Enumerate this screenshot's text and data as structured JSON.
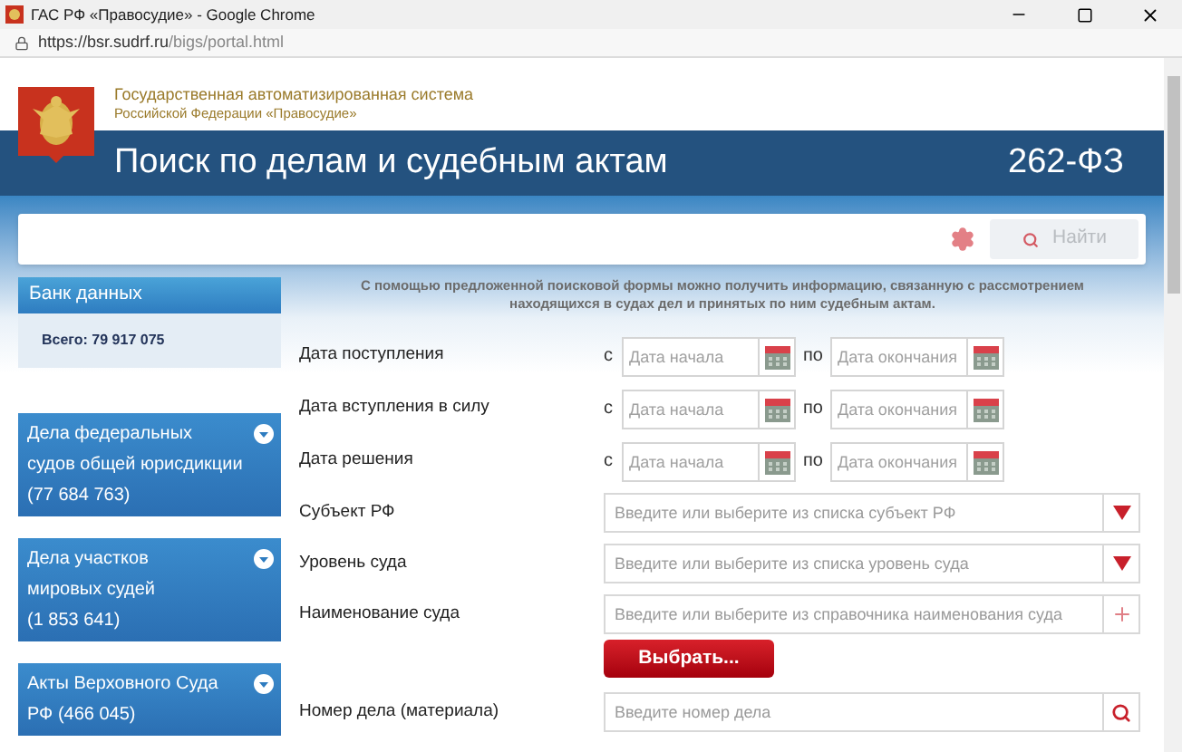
{
  "browser": {
    "tab_title": "ГАС РФ «Правосудие» - Google Chrome",
    "url_host": "https://bsr.sudrf.ru",
    "url_path": "/bigs/portal.html"
  },
  "header": {
    "system_name": "Государственная автоматизированная система",
    "system_subtitle": "Российской Федерации «Правосудие»",
    "title": "Поиск по делам и судебным актам",
    "law": "262-ФЗ"
  },
  "search": {
    "button": "Найти"
  },
  "sidebar": {
    "databank_title": "Банк данных",
    "databank_total": "Всего: 79 917 075",
    "sections": [
      {
        "lines": [
          "Дела федеральных",
          "судов общей юрисдикции",
          "(77 684 763)"
        ],
        "expanded": false
      },
      {
        "lines": [
          "Дела участков",
          "мировых судей",
          "(1 853 641)"
        ],
        "expanded": false
      },
      {
        "lines": [
          "Акты Верховного Суда",
          "РФ (466 045)"
        ],
        "expanded": false
      }
    ]
  },
  "intro": "С помощью предложенной поисковой формы можно получить информацию, связанную с рассмотрением находящихся в судах дел и принятых по ним судебным актам.",
  "fields": [
    {
      "kind": "date_range",
      "label": "Дата поступления",
      "from_label": "с",
      "from_placeholder": "Дата начала",
      "to_label": "по",
      "to_placeholder": "Дата окончания"
    },
    {
      "kind": "date_range",
      "label": "Дата вступления в силу",
      "from_label": "с",
      "from_placeholder": "Дата начала",
      "to_label": "по",
      "to_placeholder": "Дата окончания"
    },
    {
      "kind": "date_range",
      "label": "Дата решения",
      "from_label": "с",
      "from_placeholder": "Дата начала",
      "to_label": "по",
      "to_placeholder": "Дата окончания"
    },
    {
      "kind": "dropdown",
      "label": "Субъект РФ",
      "placeholder": "Введите или выберите из списка субъект РФ"
    },
    {
      "kind": "dropdown",
      "label": "Уровень суда",
      "placeholder": "Введите или выберите из списка уровень суда"
    },
    {
      "kind": "directory",
      "label": "Наименование суда",
      "placeholder": "Введите или выберите из справочника наименования суда",
      "button": "Выбрать..."
    },
    {
      "kind": "search",
      "label": "Номер дела (материала)",
      "placeholder": "Введите номер дела"
    }
  ]
}
